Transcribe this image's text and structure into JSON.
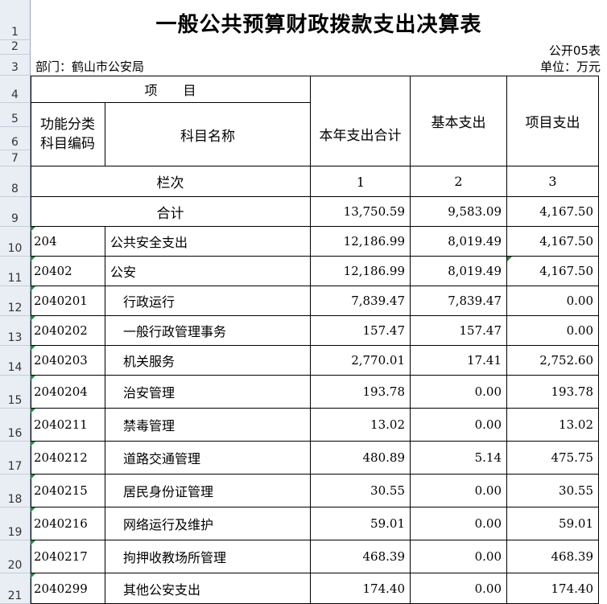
{
  "title": "一般公共预算财政拨款支出决算表",
  "table_no": "公开05表",
  "department": "部门：鹤山市公安局",
  "unit": "单位：万元",
  "row_numbers": [
    "1",
    "2",
    "3",
    "4",
    "5",
    "6",
    "7",
    "8",
    "9",
    "10",
    "11",
    "12",
    "13",
    "14",
    "15",
    "16",
    "17",
    "18",
    "19",
    "20",
    "21"
  ],
  "headers": {
    "project": "项　　目",
    "func_code": "功能分类科目编码",
    "subject_name": "科目名称",
    "total": "本年支出合计",
    "basic": "基本支出",
    "project_exp": "项目支出",
    "column_label": "栏次",
    "col1": "1",
    "col2": "2",
    "col3": "3"
  },
  "sum_row": {
    "label": "合计",
    "total": "13,750.59",
    "basic": "9,583.09",
    "project": "4,167.50"
  },
  "rows": [
    {
      "code": "204",
      "name": "公共安全支出",
      "total": "12,186.99",
      "basic": "8,019.49",
      "project": "4,167.50"
    },
    {
      "code": "20402",
      "name": "公安",
      "total": "12,186.99",
      "basic": "8,019.49",
      "project": "4,167.50"
    },
    {
      "code": "2040201",
      "name": "行政运行",
      "total": "7,839.47",
      "basic": "7,839.47",
      "project": "0.00"
    },
    {
      "code": "2040202",
      "name": "一般行政管理事务",
      "total": "157.47",
      "basic": "157.47",
      "project": "0.00"
    },
    {
      "code": "2040203",
      "name": "机关服务",
      "total": "2,770.01",
      "basic": "17.41",
      "project": "2,752.60"
    },
    {
      "code": "2040204",
      "name": "治安管理",
      "total": "193.78",
      "basic": "0.00",
      "project": "193.78"
    },
    {
      "code": "2040211",
      "name": "禁毒管理",
      "total": "13.02",
      "basic": "0.00",
      "project": "13.02"
    },
    {
      "code": "2040212",
      "name": "道路交通管理",
      "total": "480.89",
      "basic": "5.14",
      "project": "475.75"
    },
    {
      "code": "2040215",
      "name": "居民身份证管理",
      "total": "30.55",
      "basic": "0.00",
      "project": "30.55"
    },
    {
      "code": "2040216",
      "name": "网络运行及维护",
      "total": "59.01",
      "basic": "0.00",
      "project": "59.01"
    },
    {
      "code": "2040217",
      "name": "拘押收教场所管理",
      "total": "468.39",
      "basic": "0.00",
      "project": "468.39"
    },
    {
      "code": "2040299",
      "name": "其他公安支出",
      "total": "174.40",
      "basic": "0.00",
      "project": "174.40"
    }
  ]
}
